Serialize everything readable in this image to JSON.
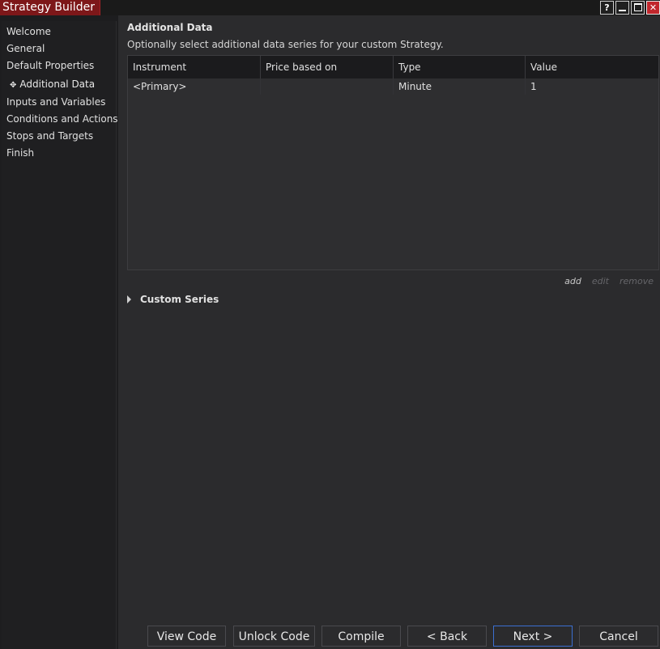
{
  "window": {
    "title": "Strategy Builder",
    "buttons": {
      "help": "?",
      "close": "✕"
    }
  },
  "sidebar": {
    "items": [
      {
        "label": "Welcome"
      },
      {
        "label": "General"
      },
      {
        "label": "Default Properties"
      },
      {
        "label": "Additional Data",
        "active": true
      },
      {
        "label": "Inputs and Variables"
      },
      {
        "label": "Conditions and Actions"
      },
      {
        "label": "Stops and Targets"
      },
      {
        "label": "Finish"
      }
    ]
  },
  "main": {
    "heading": "Additional Data",
    "subheading": "Optionally select additional data series for your custom Strategy.",
    "grid": {
      "columns": [
        "Instrument",
        "Price based on",
        "Type",
        "Value"
      ],
      "rows": [
        [
          "<Primary>",
          "",
          "Minute",
          "1"
        ]
      ]
    },
    "grid_actions": {
      "add": "add",
      "edit": "edit",
      "remove": "remove"
    },
    "custom_series": "Custom Series"
  },
  "footer": {
    "view_code": "View Code",
    "unlock_code": "Unlock Code",
    "compile": "Compile",
    "back": "< Back",
    "next": "Next >",
    "cancel": "Cancel"
  },
  "colors": {
    "title_accent": "#7d1719",
    "close_button": "#c1272d",
    "focus_border": "#3b6fd1",
    "background": "#2b2b2d"
  }
}
